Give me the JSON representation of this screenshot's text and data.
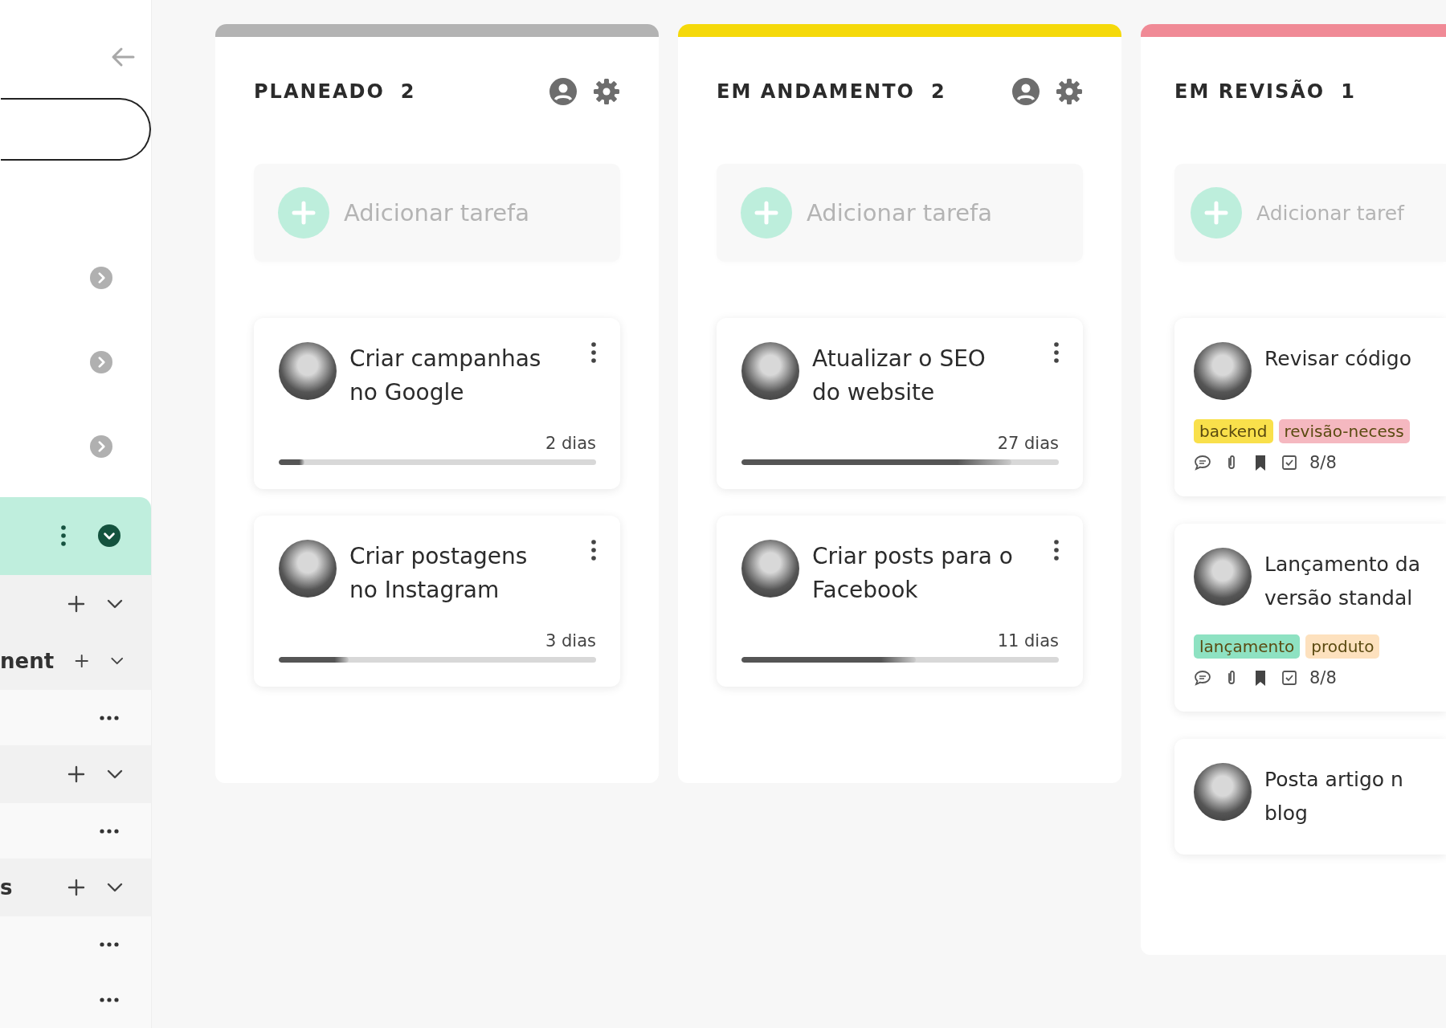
{
  "sidebar": {
    "pill_field": {
      "kind": "outline"
    },
    "rows": [
      {
        "kind": "chevron"
      },
      {
        "kind": "chevron"
      },
      {
        "kind": "chevron"
      },
      {
        "kind": "active"
      },
      {
        "kind": "add"
      },
      {
        "kind": "add",
        "label": "nent"
      },
      {
        "kind": "more"
      },
      {
        "kind": "add"
      },
      {
        "kind": "more"
      },
      {
        "kind": "add",
        "label": "s"
      },
      {
        "kind": "more"
      },
      {
        "kind": "more"
      }
    ]
  },
  "columns": [
    {
      "title": "PLANEADO",
      "count": "2",
      "color": "#b3b3b3",
      "header_icons": true,
      "add_task": "Adicionar tarefa",
      "cards": [
        {
          "kind": "progress",
          "title_lines": [
            "Criar campanhas",
            "no Google"
          ],
          "due": "2 dias",
          "level": 0.08
        },
        {
          "kind": "progress",
          "title_lines": [
            "Criar postagens",
            "no Instagram"
          ],
          "due": "3 dias",
          "level": 0.22
        }
      ]
    },
    {
      "title": "EM ANDAMENTO",
      "count": "2",
      "color": "#f5d90a",
      "header_icons": true,
      "add_task": "Adicionar tarefa",
      "cards": [
        {
          "kind": "progress",
          "title_lines": [
            "Atualizar o SEO",
            "do website"
          ],
          "due": "27 dias",
          "level": 0.85
        },
        {
          "kind": "progress",
          "title_lines": [
            "Criar posts para o",
            "Facebook"
          ],
          "due": "11 dias",
          "level": 0.55
        }
      ]
    },
    {
      "title": "EM REVISÃO",
      "count": "1",
      "color": "#f08a96",
      "header_icons": false,
      "add_task": "Adicionar taref",
      "cards": [
        {
          "kind": "tags",
          "title_lines": [
            "Revisar código"
          ],
          "tags": [
            {
              "label": "backend",
              "color": "#f9e04b"
            },
            {
              "label": "revisão-necess",
              "color": "#f5b8c0"
            }
          ],
          "checklist": "8/8"
        },
        {
          "kind": "tags",
          "title_lines": [
            "Lançamento da",
            "versão standal"
          ],
          "tags": [
            {
              "label": "lançamento",
              "color": "#8ee2c2"
            },
            {
              "label": "produto",
              "color": "#fde1be"
            }
          ],
          "checklist": "8/8"
        },
        {
          "kind": "plain",
          "title_lines": [
            "Posta artigo n",
            "blog"
          ]
        }
      ]
    }
  ]
}
